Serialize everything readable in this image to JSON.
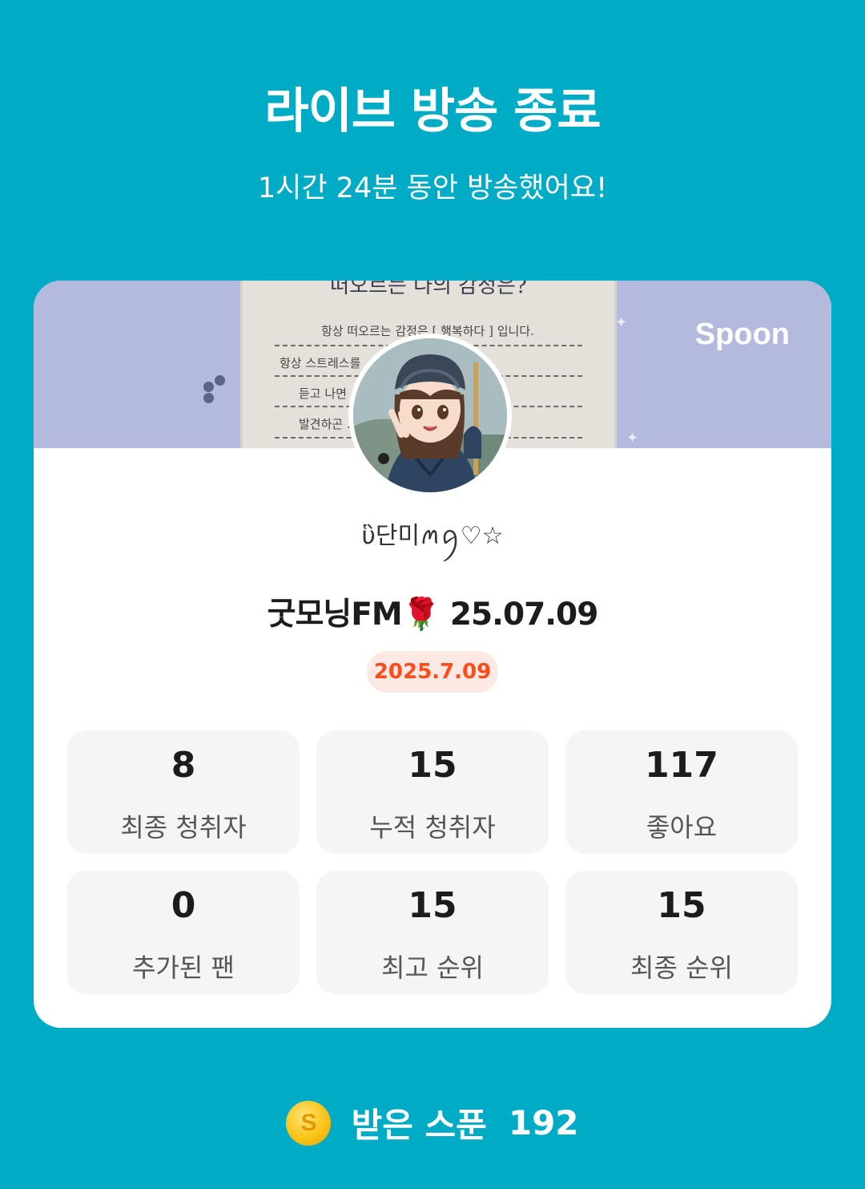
{
  "header": {
    "title": "라이브 방송 종료",
    "subtitle": "1시간 24분 동안 방송했어요!"
  },
  "card": {
    "banner": {
      "logo": "Spoon",
      "paper_heading": "떠오르는 나의 감정은?",
      "paper_lines": [
        "항상 떠오르는 감정은 [ 행복하다 ] 입니다.",
        "항상 스트레스를 ...                ...님의 방송을",
        "듣고 나면 ...                         내모습을",
        "발견하곤 ...                          스트레스는"
      ]
    },
    "avatar_icon": "profile-avatar",
    "nickname": "ὓ단미ꪔꪇ♡☆",
    "live_title": "굿모닝FM🌹 25.07.09",
    "date": "2025.7.09",
    "date_color": "#ff4c1a",
    "stats": [
      {
        "value": "8",
        "label": "최종 청취자"
      },
      {
        "value": "15",
        "label": "누적 청취자"
      },
      {
        "value": "117",
        "label": "좋아요"
      },
      {
        "value": "0",
        "label": "추가된 팬"
      },
      {
        "value": "15",
        "label": "최고 순위"
      },
      {
        "value": "15",
        "label": "최종 순위"
      }
    ]
  },
  "footer": {
    "coin_icon": "spoon-coin-icon",
    "coin_symbol": "S",
    "label": "받은 스푼",
    "value": "192"
  },
  "colors": {
    "background": "#00abc6",
    "banner": "#b4badd",
    "stat_bg": "#f5f5f5",
    "badge_bg": "#fde9e4"
  }
}
